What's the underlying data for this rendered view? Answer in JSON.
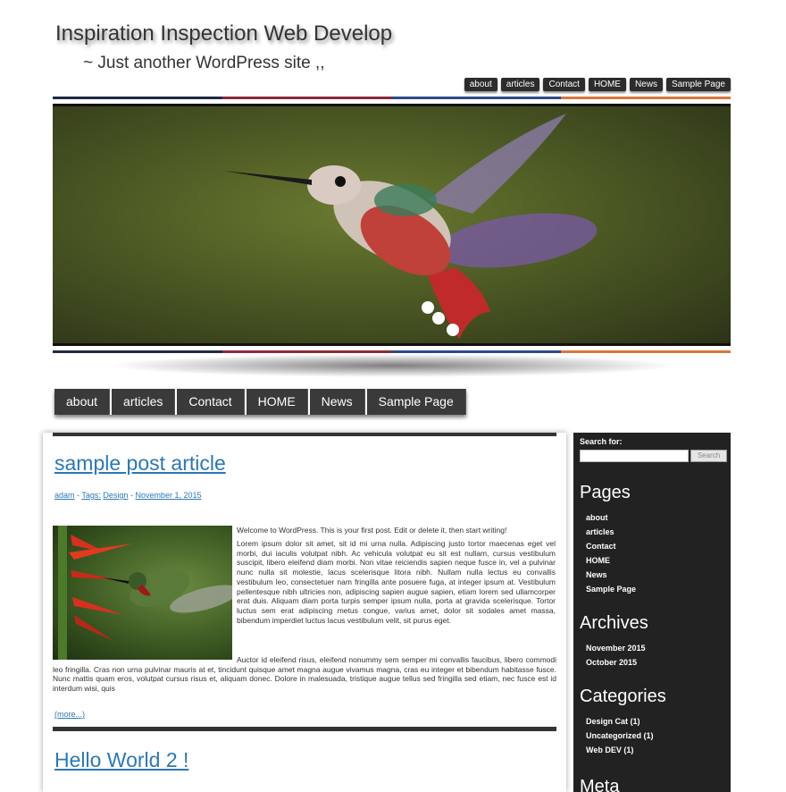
{
  "site": {
    "title": "Inspiration Inspection Web Develop",
    "description": "~ Just another WordPress site ,,"
  },
  "top_nav": [
    "about",
    "articles",
    "Contact",
    "HOME",
    "News",
    "Sample Page"
  ],
  "main_nav": [
    "about",
    "articles",
    "Contact",
    "HOME",
    "News",
    "Sample Page"
  ],
  "colors": {
    "stripe": [
      "#1f2a44",
      "#8a2b3a",
      "#2c4a8a",
      "#d8783a"
    ],
    "link": "#2a78b8",
    "sidebar_bg": "#222222",
    "nav_bg": "#3a3a3a"
  },
  "posts": [
    {
      "title": "sample post article",
      "author": "adam",
      "tags_label": "Tags:",
      "tag": "Design",
      "date": "November 1, 2015",
      "intro": "Welcome to WordPress. This is your first post. Edit or delete it, then start writing!",
      "body1": "Lorem ipsum dolor sit amet, sit id mi urna nulla. Adipiscing justo tortor maecenas eget vel morbi, dui iaculis volutpat nibh. Ac vehicula volutpat eu sit est nullam, cursus vestibulum suscipit, libero eleifend diam morbi. Non vitae reiciendis sapien neque fusce in, vel a pulvinar nunc nulla sit molestie, lacus scelerisque litora nibh. Nullam nulla lectus eu convallis vestibulum leo, consectetuer nam fringilla ante posuere fuga, at integer ipsum at. Vestibulum pellentesque nibh ultricies non, adipiscing sapien augue sapien, etiam lorem sed ullamcorper erat duis. Aliquam diam porta turpis semper ipsum nulla, porta at gravida scelerisque. Tortor luctus sem erat adipiscing metus congue, varius amet, dolor sit sodales amet massa, bibendum imperdiet luctus lacus vestibulum velit, sit purus eget.",
      "body2": "Auctor id eleifend risus, eleifend nonummy sem semper mi convallis faucibus, libero commodi leo fringilla. Cras non urna pulvinar mauris at et, tincidunt quisque amet magna augue vivamus magna, cras eu integer et bibendum habitasse fusce. Nunc mattis quam eros, volutpat cursus risus et, aliquam donec. Dolore in malesuada, tristique augue tellus sed fringilla sed etiam, nec fusce est id interdum wisi, quis",
      "more": "(more...)"
    },
    {
      "title": "Hello World 2 !"
    }
  ],
  "sidebar": {
    "search_label": "Search for:",
    "search_placeholder": "",
    "search_button": "Search",
    "pages_heading": "Pages",
    "pages": [
      "about",
      "articles",
      "Contact",
      "HOME",
      "News",
      "Sample Page"
    ],
    "archives_heading": "Archives",
    "archives": [
      "November 2015",
      "October 2015"
    ],
    "categories_heading": "Categories",
    "categories": [
      "Design Cat  (1)",
      "Uncategorized  (1)",
      "Web DEV  (1)"
    ],
    "meta_heading": "Meta"
  }
}
